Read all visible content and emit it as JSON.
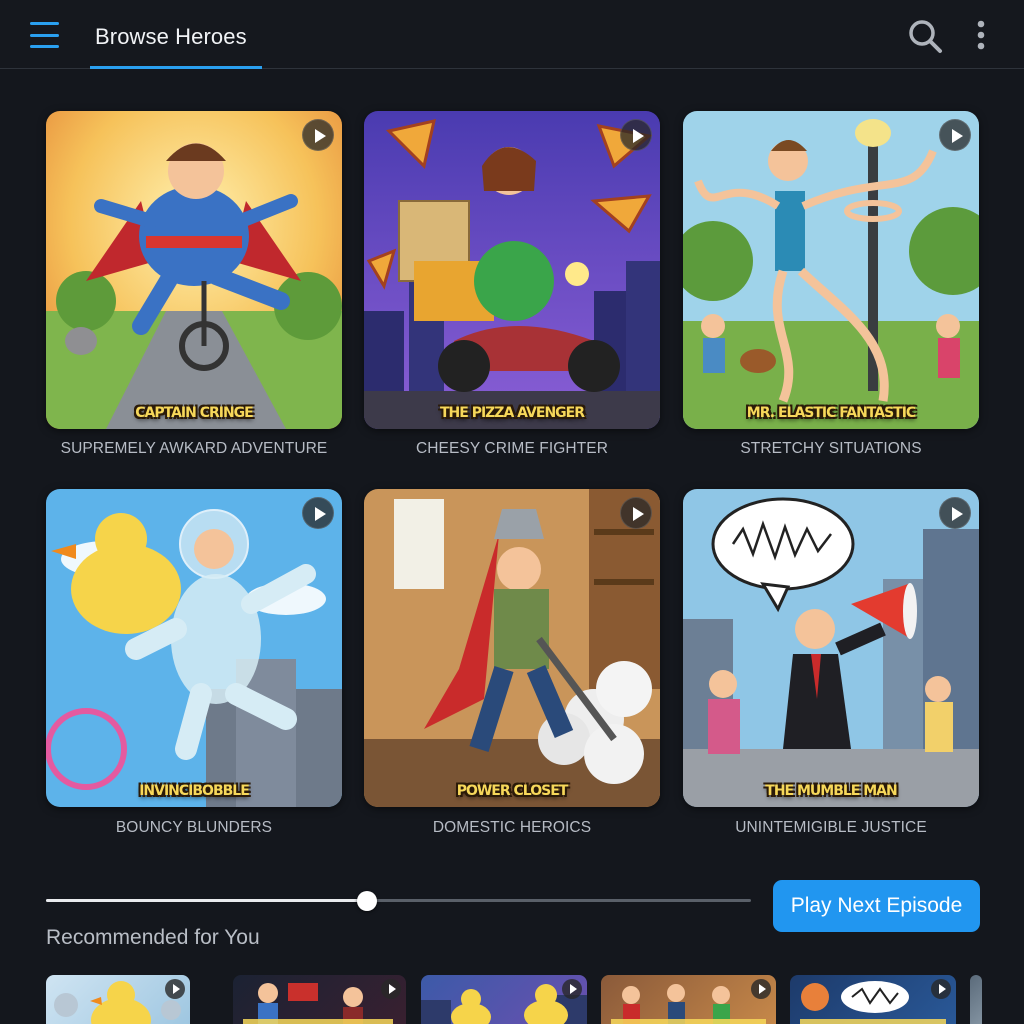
{
  "header": {
    "tab_label": "Browse Heroes",
    "menu_icon": "hamburger-menu-icon",
    "search_icon": "search-icon",
    "more_icon": "more-vertical-icon",
    "accent": "#2aa0f0"
  },
  "heroes": [
    {
      "title": "CAPTAIN CRINGE",
      "caption": "SUPREMELY AWKARD ADVENTURE"
    },
    {
      "title": "THE PIZZA AVENGER",
      "caption": "CHEESY CRIME FIGHTER"
    },
    {
      "title": "MR. ELASTIC FANTASTIC",
      "caption": "STRETCHY SITUATIONS"
    },
    {
      "title": "INVINCIBOBBLE",
      "caption": "BOUNCY BLUNDERS"
    },
    {
      "title": "POWER CLOSET",
      "caption": "DOMESTIC HEROICS"
    },
    {
      "title": "THE MUMBLE MAN",
      "caption": "UNINTEMIGIBLE JUSTICE"
    }
  ],
  "player": {
    "progress": 0.455,
    "play_next_label": "Play Next Episode",
    "button_color": "#2196f0"
  },
  "recommended": {
    "title": "Recommended for You",
    "items": [
      {
        "name": "rubber-duck-thumbnail"
      },
      {
        "name": "captain-cringe-thumbnail"
      },
      {
        "name": "duck-city-thumbnail"
      },
      {
        "name": "crowd-scene-thumbnail"
      },
      {
        "name": "mumble-scene-thumbnail"
      },
      {
        "name": "partial-thumbnail"
      }
    ]
  }
}
